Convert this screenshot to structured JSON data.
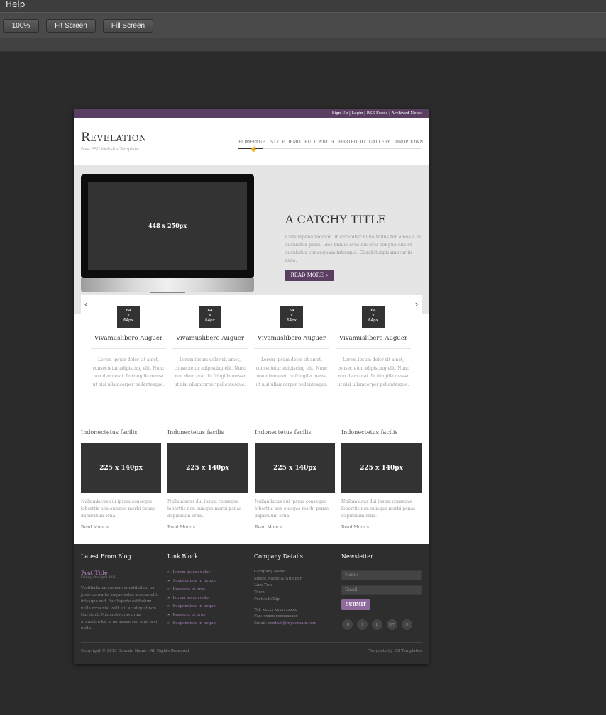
{
  "menubar": {
    "help": "Help"
  },
  "toolbar": {
    "btn_100": "100%",
    "btn_fit": "Fit Screen",
    "btn_fill": "Fill Screen"
  },
  "site": {
    "topstrip": "Sign Up | Login | RSS Feeds | Archived News",
    "logo": "Revelation",
    "logo_sub": "Free PSD Website Template",
    "nav": [
      "HOMEPAGE",
      "STYLE DEMO",
      "FULL WIDTH",
      "PORTFOLIO",
      "GALLERY",
      "DROPDOWN"
    ],
    "hero": {
      "image_label": "448 x 250px",
      "title": "A CATCHY TITLE",
      "text": "Cursuspenatiaccum ut curabitur nulla tellus tor ames a in curabitur pede. Idet mollis eros dis orci congue elis et curabitur consequam intesque. Curabiturpisametur in ante.",
      "button": "READ MORE »"
    },
    "carousel": {
      "prev": "‹",
      "next": "›",
      "items": [
        {
          "thumb": "64 x 64px",
          "title": "Vivamuslibero Auguer",
          "text": "Lorem ipsum dolor sit amet, consectetur adipiscing elit. Nunc non diam erat. In fringilla massa ut nisi ullamcorper pellentesque."
        },
        {
          "thumb": "64 x 64px",
          "title": "Vivamuslibero Auguer",
          "text": "Lorem ipsum dolor sit amet, consectetur adipiscing elit. Nunc non diam erat. In fringilla massa ut nisi ullamcorper pellentesque."
        },
        {
          "thumb": "64 x 64px",
          "title": "Vivamuslibero Auguer",
          "text": "Lorem ipsum dolor sit amet, consectetur adipiscing elit. Nunc non diam erat. In fringilla massa ut nisi ullamcorper pellentesque."
        },
        {
          "thumb": "64 x 64px",
          "title": "Vivamuslibero Auguer",
          "text": "Lorem ipsum dolor sit amet, consectetur adipiscing elit. Nunc non diam erat. In fringilla massa ut nisi ullamcorper pellentesque."
        }
      ]
    },
    "features": [
      {
        "heading": "Indonectetus facilis",
        "image": "225 x 140px",
        "text": "Nullamlacus dui ipsum conseque loborttis non euisque morbi penas dapibulum orna.",
        "link": "Read More »"
      },
      {
        "heading": "Indonectetus facilis",
        "image": "225 x 140px",
        "text": "Nullamlacus dui ipsum conseque loborttis non euisque morbi penas dapibulum orna.",
        "link": "Read More »"
      },
      {
        "heading": "Indonectetus facilis",
        "image": "225 x 140px",
        "text": "Nullamlacus dui ipsum conseque loborttis non euisque morbi penas dapibulum orna.",
        "link": "Read More »"
      },
      {
        "heading": "Indonectetus facilis",
        "image": "225 x 140px",
        "text": "Nullamlacus dui ipsum conseque loborttis non euisque morbi penas dapibulum orna.",
        "link": "Read More »"
      }
    ],
    "footer": {
      "blog_heading": "Latest From Blog",
      "post_title": "Post Title",
      "post_date": "Friday, 6th April 2012",
      "post_text": "Vestibulumaccumsan egestibulum eu justo convallis augue estas aenean elit intesque sed. Facilispede estibulum nulla orna nisl velit elit ac aliquat non tincidunt. Namjusto cras urna urnarotra kir urna neque sed quis orci nulla.",
      "links_heading": "Link Block",
      "links": [
        "Lorem ipsum dolor",
        "Suspendisse in neque",
        "Praesent et eros",
        "Lorem ipsum dolor",
        "Suspendisse in neque",
        "Praesent et eros",
        "Suspendisse in neque"
      ],
      "company_heading": "Company Details",
      "company_lines": [
        "Company Name",
        "Street Name & Number",
        "Line Two",
        "Town",
        "Postcode/Zip"
      ],
      "tel": "Tel: xxxxx xxxxxxxxxx",
      "fax": "Fax: xxxxx xxxxxxxxxx",
      "email_label": "Email: ",
      "email": "contact@mydomain.com",
      "newsletter_heading": "Newsletter",
      "name_placeholder": "Name",
      "email_placeholder": "Email",
      "submit": "SUBMIT",
      "social_icons": [
        "linkedin-icon",
        "twitter-icon",
        "pinterest-icon",
        "googleplus-icon",
        "rss-icon"
      ],
      "copyright": "Copyright © 2013 Domain Name - All Rights Reserved",
      "credit": "Template by OS Templates"
    }
  }
}
